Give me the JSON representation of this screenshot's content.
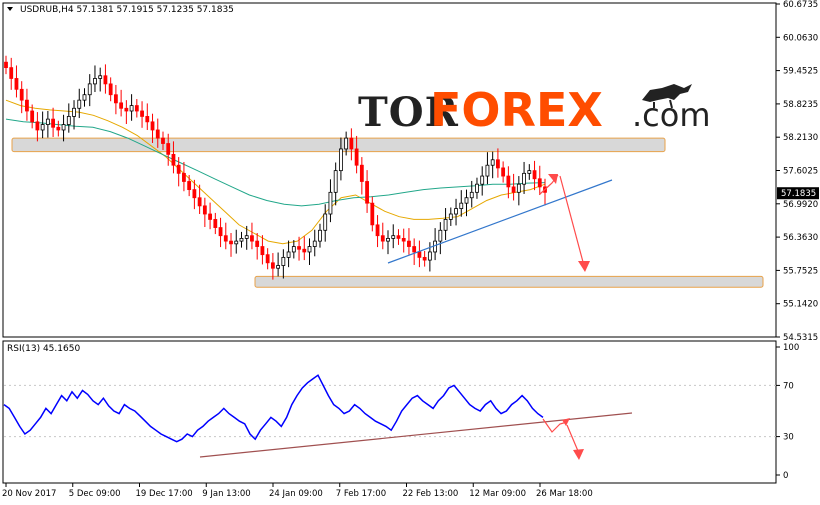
{
  "header": {
    "symbol_line": "USDRUB,H4  57.1381 57.1915 57.1235 57.1835",
    "rsi_line": "RSI(13) 45.1650"
  },
  "watermark": {
    "part1": "TOR",
    "part2": "FOREX",
    "part3": ".com",
    "colors": {
      "part1": "#222222",
      "part2": "#ff4d00",
      "part3": "#222222"
    }
  },
  "chart_data": [
    {
      "type": "candlestick",
      "title": "USDRUB,H4",
      "ylim": [
        54.5315,
        60.6735
      ],
      "y_ticks": [
        "60.6735",
        "60.0630",
        "59.4525",
        "58.8235",
        "58.2130",
        "57.6025",
        "56.9920",
        "56.3630",
        "55.7525",
        "55.1420",
        "54.5315"
      ],
      "current_price": "57.1835",
      "x_ticks": [
        "20 Nov 2017",
        "5 Dec 09:00",
        "19 Dec 17:00",
        "9 Jan 13:00",
        "24 Jan 09:00",
        "7 Feb 17:00",
        "22 Feb 13:00",
        "12 Mar 09:00",
        "26 Mar 18:00"
      ],
      "close_series": [
        59.5,
        59.3,
        59.1,
        58.9,
        58.7,
        58.5,
        58.35,
        58.45,
        58.55,
        58.4,
        58.35,
        58.45,
        58.6,
        58.75,
        58.9,
        59.0,
        59.2,
        59.3,
        59.35,
        59.2,
        59.0,
        58.85,
        58.75,
        58.7,
        58.8,
        58.7,
        58.6,
        58.5,
        58.35,
        58.2,
        58.1,
        57.9,
        57.7,
        57.55,
        57.4,
        57.25,
        57.1,
        56.95,
        56.8,
        56.7,
        56.55,
        56.4,
        56.3,
        56.25,
        56.3,
        56.35,
        56.4,
        56.3,
        56.2,
        56.05,
        55.9,
        55.8,
        55.85,
        56.0,
        56.1,
        56.2,
        56.15,
        56.1,
        56.2,
        56.3,
        56.5,
        56.8,
        57.2,
        57.6,
        58.0,
        58.2,
        58.0,
        57.7,
        57.4,
        57.0,
        56.6,
        56.4,
        56.3,
        56.35,
        56.4,
        56.35,
        56.3,
        56.2,
        56.1,
        56.0,
        55.95,
        56.1,
        56.3,
        56.5,
        56.7,
        56.8,
        56.9,
        57.0,
        57.1,
        57.2,
        57.35,
        57.5,
        57.7,
        57.8,
        57.65,
        57.5,
        57.3,
        57.2,
        57.35,
        57.55,
        57.6,
        57.45,
        57.3,
        57.2
      ],
      "ma_fast": [
        58.9,
        58.8,
        58.75,
        58.72,
        58.7,
        58.68,
        58.62,
        58.52,
        58.4,
        58.25,
        58.05,
        57.85,
        57.6,
        57.35,
        57.1,
        56.85,
        56.6,
        56.45,
        56.3,
        56.25,
        56.3,
        56.5,
        56.85,
        57.1,
        57.15,
        57.0,
        56.85,
        56.75,
        56.7,
        56.7,
        56.72,
        56.75,
        56.9,
        57.05,
        57.15,
        57.2,
        57.25,
        57.35
      ],
      "ma_slow": [
        58.55,
        58.5,
        58.48,
        58.45,
        58.42,
        58.4,
        58.32,
        58.2,
        58.05,
        57.9,
        57.75,
        57.6,
        57.45,
        57.3,
        57.15,
        57.05,
        56.98,
        56.95,
        56.98,
        57.05,
        57.1,
        57.12,
        57.15,
        57.2,
        57.25,
        57.28,
        57.3,
        57.32,
        57.35,
        57.35,
        57.37,
        57.38
      ],
      "zones": [
        {
          "name": "resistance",
          "from": 57.95,
          "to": 58.2
        },
        {
          "name": "support",
          "from": 55.45,
          "to": 55.65
        }
      ],
      "colors": {
        "up": "#000000",
        "down": "#ff0000",
        "ma_fast": "#e6a800",
        "ma_slow": "#22a78a",
        "trend": "#3377cc",
        "arrow": "#ff4b4b"
      }
    },
    {
      "type": "line",
      "title": "RSI(13)",
      "ylim": [
        0,
        100
      ],
      "y_ticks": [
        "100",
        "70",
        "30",
        "0"
      ],
      "values": [
        55,
        52,
        45,
        38,
        32,
        35,
        40,
        45,
        52,
        48,
        55,
        62,
        58,
        65,
        60,
        66,
        63,
        58,
        55,
        60,
        54,
        50,
        48,
        55,
        52,
        50,
        46,
        42,
        38,
        35,
        32,
        30,
        28,
        26,
        28,
        32,
        30,
        35,
        38,
        42,
        45,
        48,
        52,
        48,
        45,
        42,
        40,
        32,
        28,
        35,
        40,
        45,
        42,
        38,
        45,
        55,
        62,
        68,
        72,
        75,
        78,
        70,
        62,
        55,
        52,
        48,
        50,
        55,
        52,
        48,
        45,
        42,
        40,
        38,
        35,
        42,
        50,
        55,
        60,
        62,
        58,
        55,
        52,
        58,
        62,
        68,
        70,
        65,
        60,
        55,
        52,
        50,
        55,
        58,
        52,
        48,
        50,
        55,
        58,
        62,
        58,
        52,
        48,
        45
      ],
      "colors": {
        "line": "#0000ff",
        "trend": "#a05050",
        "arrow": "#ff4b4b"
      }
    }
  ]
}
